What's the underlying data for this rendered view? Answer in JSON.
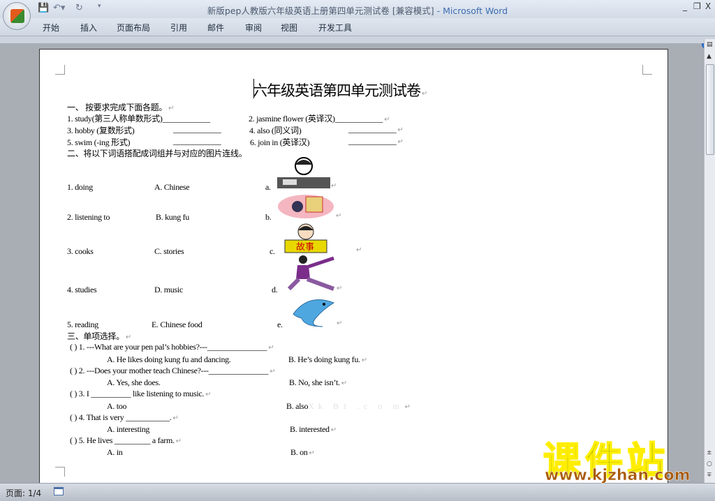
{
  "window": {
    "title": "新版pep人教版六年级英语上册第四单元测试卷 [兼容模式]",
    "app": " - Microsoft Word",
    "controls": [
      "_",
      "❐",
      "X"
    ]
  },
  "ribbon": {
    "tabs": [
      "开始",
      "插入",
      "页面布局",
      "引用",
      "邮件",
      "审阅",
      "视图",
      "开发工具"
    ],
    "help": "?"
  },
  "doc": {
    "title": "六年级英语第四单元测试卷",
    "s1": "一、  按要求完成下面各题。",
    "s1_items": [
      "1. study(第三人称单数形式)____________",
      "2. jasmine flower (英译汉)____________",
      "3. hobby (复数形式)",
      "____________",
      "4. also (同义词)",
      "____________",
      "5. swim (-ing 形式)",
      "____________",
      "6. join in (英译汉)",
      "____________"
    ],
    "s2": "二、将以下词语搭配成词组并与对应的图片连线。",
    "s2_col1": [
      "1. doing",
      "2. listening to",
      "3. cooks",
      "4. studies",
      "5. reading"
    ],
    "s2_col2": [
      "A. Chinese",
      "B. kung fu",
      "C. stories",
      "D. music",
      "E. Chinese food"
    ],
    "s2_col3": [
      "a.",
      "b.",
      "c.",
      "d.",
      "e."
    ],
    "s3": "三、单项选择。",
    "q": [
      {
        "num": "(      ) 1. ---What are your pen pal’s hobbies?---_______________",
        "a": "A. He likes doing kung fu and dancing.",
        "b": "B. He’s doing kung fu."
      },
      {
        "num": "(      ) 2. ---Does your mother teach Chinese?---_______________",
        "a": "A. Yes, she does.",
        "b": "B. No, she isn’t."
      },
      {
        "num": "(      ) 3. I __________ like listening to music.",
        "a": "A. too",
        "b": "B. also"
      },
      {
        "num": "(      ) 4. That is very ___________.",
        "a": "A. interesting",
        "b": "B. interested"
      },
      {
        "num": "(      ) 5. He lives _________ a farm.",
        "a": "A. in",
        "b": "B. on"
      }
    ],
    "watermark": "Xk B1 .c o m",
    "pic_text": "故事"
  },
  "status": {
    "page": "页面: 1/4"
  },
  "brand": {
    "name": "课件站",
    "url": "www.kjzhan.com"
  }
}
